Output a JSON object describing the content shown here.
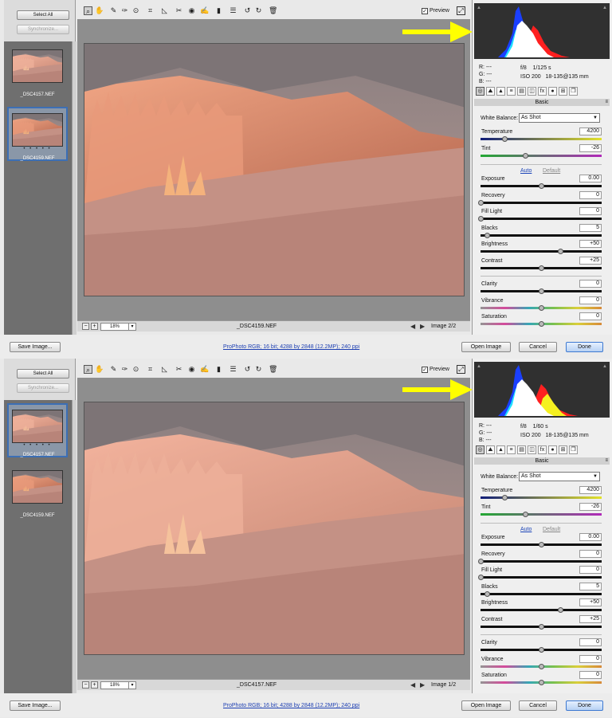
{
  "panels": [
    {
      "select_all_label": "Select All",
      "synchronize_label": "Synchronize...",
      "filmstrip": [
        {
          "name": "_DSC4157.NEF",
          "selected": false,
          "dots": ""
        },
        {
          "name": "_DSC4159.NEF",
          "selected": true,
          "dots": "• • • • •"
        }
      ],
      "preview_label": "Preview",
      "preview_checked": "✓",
      "zoom": "18%",
      "filename": "_DSC4159.NEF",
      "image_count": "Image 2/2",
      "rgb": {
        "r": "R: ---",
        "g": "G: ---",
        "b": "B: ---"
      },
      "aperture": "f/8",
      "shutter": "1/125 s",
      "iso": "ISO 200",
      "lens": "18-135@135 mm",
      "panel_title": "Basic",
      "wb_label": "White Balance:",
      "wb_value": "As Shot",
      "auto_label": "Auto",
      "default_label": "Default",
      "sliders": [
        {
          "label": "Temperature",
          "value": "4200",
          "pos": 0.2,
          "track": "t2"
        },
        {
          "label": "Tint",
          "value": "-26",
          "pos": 0.37,
          "track": "t3"
        },
        {
          "label": "Exposure",
          "value": "0.00",
          "pos": 0.5,
          "track": "t1"
        },
        {
          "label": "Recovery",
          "value": "0",
          "pos": 0.0,
          "track": "t1"
        },
        {
          "label": "Fill Light",
          "value": "0",
          "pos": 0.0,
          "track": "t1"
        },
        {
          "label": "Blacks",
          "value": "5",
          "pos": 0.05,
          "track": "t1"
        },
        {
          "label": "Brightness",
          "value": "+50",
          "pos": 0.66,
          "track": "t1"
        },
        {
          "label": "Contrast",
          "value": "+25",
          "pos": 0.5,
          "track": "t1"
        },
        {
          "label": "Clarity",
          "value": "0",
          "pos": 0.5,
          "track": "t1"
        },
        {
          "label": "Vibrance",
          "value": "0",
          "pos": 0.5,
          "track": "t4"
        },
        {
          "label": "Saturation",
          "value": "0",
          "pos": 0.5,
          "track": "t4"
        }
      ]
    },
    {
      "select_all_label": "Select All",
      "synchronize_label": "Synchronize...",
      "filmstrip": [
        {
          "name": "_DSC4157.NEF",
          "selected": true,
          "dots": "• • • • •"
        },
        {
          "name": "_DSC4159.NEF",
          "selected": false,
          "dots": ""
        }
      ],
      "preview_label": "Preview",
      "preview_checked": "✓",
      "zoom": "18%",
      "filename": "_DSC4157.NEF",
      "image_count": "Image 1/2",
      "rgb": {
        "r": "R: ---",
        "g": "G: ---",
        "b": "B: ---"
      },
      "aperture": "f/8",
      "shutter": "1/60 s",
      "iso": "ISO 200",
      "lens": "18-135@135 mm",
      "panel_title": "Basic",
      "wb_label": "White Balance:",
      "wb_value": "As Shot",
      "auto_label": "Auto",
      "default_label": "Default",
      "sliders": [
        {
          "label": "Temperature",
          "value": "4200",
          "pos": 0.2,
          "track": "t2"
        },
        {
          "label": "Tint",
          "value": "-26",
          "pos": 0.37,
          "track": "t3"
        },
        {
          "label": "Exposure",
          "value": "0.00",
          "pos": 0.5,
          "track": "t1"
        },
        {
          "label": "Recovery",
          "value": "0",
          "pos": 0.0,
          "track": "t1"
        },
        {
          "label": "Fill Light",
          "value": "0",
          "pos": 0.0,
          "track": "t1"
        },
        {
          "label": "Blacks",
          "value": "5",
          "pos": 0.05,
          "track": "t1"
        },
        {
          "label": "Brightness",
          "value": "+50",
          "pos": 0.66,
          "track": "t1"
        },
        {
          "label": "Contrast",
          "value": "+25",
          "pos": 0.5,
          "track": "t1"
        },
        {
          "label": "Clarity",
          "value": "0",
          "pos": 0.5,
          "track": "t1"
        },
        {
          "label": "Vibrance",
          "value": "0",
          "pos": 0.5,
          "track": "t4"
        },
        {
          "label": "Saturation",
          "value": "0",
          "pos": 0.5,
          "track": "t4"
        }
      ]
    }
  ],
  "bottom_bar": {
    "save_label": "Save Image...",
    "workflow_link": "ProPhoto RGB; 16 bit; 4288 by 2848 (12.2MP); 240 ppi",
    "open_label": "Open Image",
    "cancel_label": "Cancel",
    "done_label": "Done"
  },
  "tool_icons": [
    "zoom-tool-icon",
    "hand-tool-icon",
    "white-balance-tool-icon",
    "color-sampler-tool-icon",
    "target-adjustment-tool-icon",
    "crop-tool-icon",
    "straighten-tool-icon",
    "spot-removal-tool-icon",
    "red-eye-tool-icon",
    "adjustment-brush-icon",
    "graduated-filter-icon",
    "preferences-icon",
    "rotate-ccw-icon",
    "rotate-cw-icon",
    "trash-icon"
  ],
  "tool_glyphs": [
    "⌕",
    "✋",
    "✎",
    "✑",
    "⊙",
    "⌗",
    "◺",
    "✂",
    "◉",
    "✍",
    "▮",
    "☰",
    "↺",
    "↻",
    "🗑"
  ],
  "tab_icons": [
    "basic-tab-icon",
    "tone-curve-tab-icon",
    "detail-tab-icon",
    "hsl-tab-icon",
    "split-toning-tab-icon",
    "lens-corrections-tab-icon",
    "fx-tab-icon",
    "camera-calibration-tab-icon",
    "presets-tab-icon",
    "snapshots-tab-icon"
  ],
  "tab_glyphs": [
    "◎",
    "⛰",
    "▲",
    "≡",
    "▤",
    "◫",
    "fx",
    "●",
    "⊞",
    "❐"
  ],
  "colors": {
    "accent": "#3c6fb5",
    "arrow": "#ffff00",
    "link": "#1d3fb2"
  }
}
